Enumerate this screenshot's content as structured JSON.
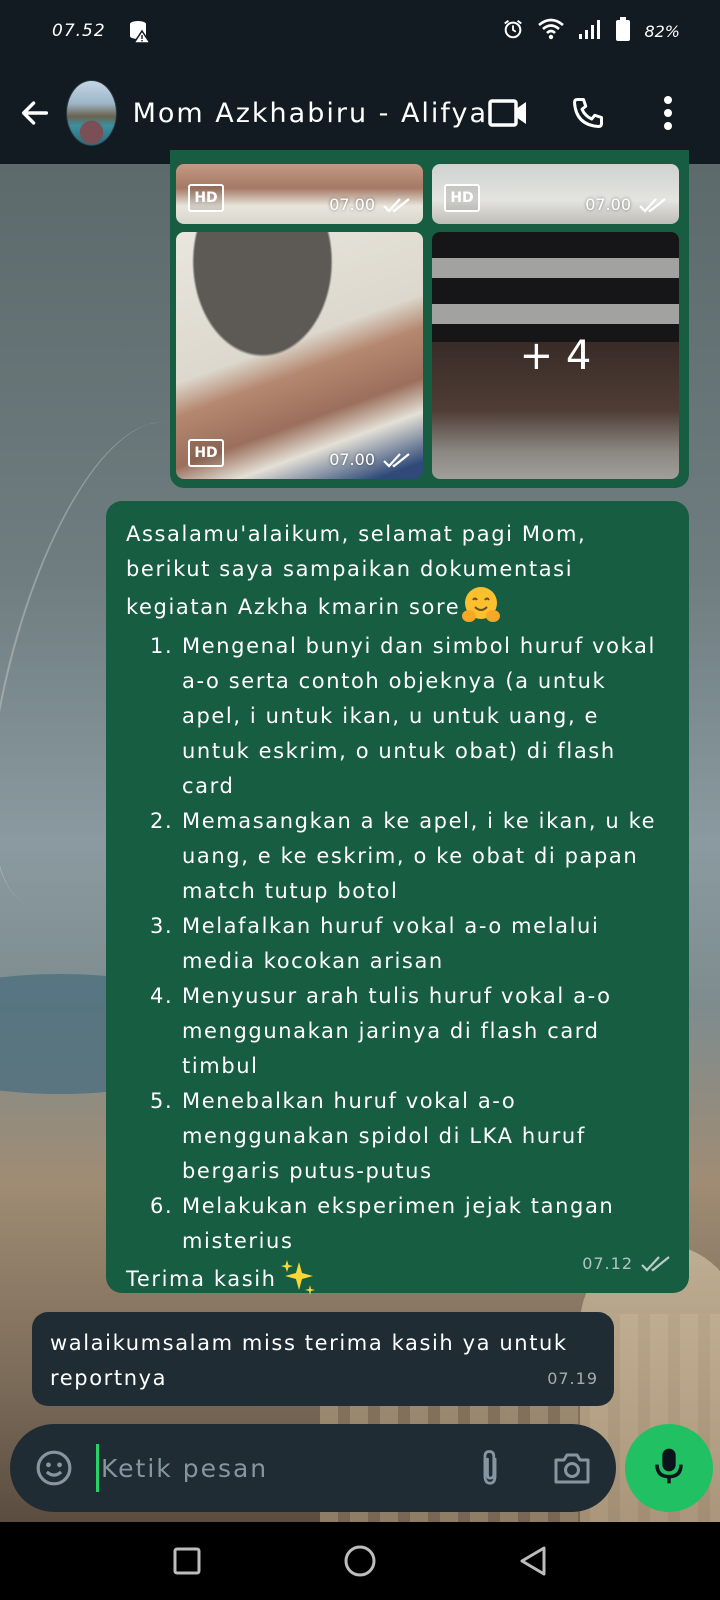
{
  "status_bar": {
    "time": "07.52",
    "battery": "82%",
    "icons": [
      "database-warning-icon",
      "alarm-icon",
      "wifi-icon",
      "signal-icon",
      "battery-icon"
    ]
  },
  "header": {
    "back_icon": "arrow-left-icon",
    "contact_name": "Mom Azkhabiru - Alifya",
    "actions": [
      "video-call-icon",
      "phone-icon",
      "more-vert-icon"
    ]
  },
  "media_grid": {
    "tiles": [
      {
        "badge": "HD",
        "time": "07.00"
      },
      {
        "badge": "HD",
        "time": "07.00"
      },
      {
        "badge": "HD",
        "time": "07.00"
      },
      {
        "more": "+ 4"
      }
    ]
  },
  "message_out": {
    "intro": "Assalamu'alaikum, selamat pagi Mom, berikut saya sampaikan dokumentasi kegiatan Azkha kmarin sore",
    "items": [
      {
        "num": "1.",
        "text": "Mengenal bunyi dan simbol huruf vokal a-o serta contoh objeknya (a untuk apel, i untuk ikan, u untuk uang, e untuk eskrim, o untuk obat) di flash card"
      },
      {
        "num": "2.",
        "text": "Memasangkan a ke apel, i ke ikan, u ke uang, e ke eskrim, o ke obat di papan match tutup botol"
      },
      {
        "num": "3.",
        "text": "Melafalkan huruf vokal a-o melalui media kocokan arisan"
      },
      {
        "num": "4.",
        "text": "Menyusur arah tulis huruf vokal a-o menggunakan jarinya di flash card timbul"
      },
      {
        "num": "5.",
        "text": "Menebalkan huruf vokal a-o menggunakan spidol di LKA huruf bergaris putus-putus"
      },
      {
        "num": "6.",
        "text": "Melakukan eksperimen jejak tangan misterius"
      }
    ],
    "closing": "Terima kasih",
    "time": "07.12"
  },
  "message_in": {
    "text": "walaikumsalam miss terima kasih ya untuk reportnya",
    "time": "07.19"
  },
  "composer": {
    "placeholder": "Ketik pesan",
    "icons": [
      "emoji-icon",
      "attach-icon",
      "camera-icon",
      "mic-icon"
    ]
  },
  "nav_bar": {
    "buttons": [
      "recents-square-icon",
      "home-circle-icon",
      "back-triangle-icon"
    ]
  },
  "colors": {
    "outgoing_bubble": "#175d42",
    "incoming_bubble": "#202c33",
    "header_bg": "#111b21",
    "accent_green": "#21c063"
  }
}
